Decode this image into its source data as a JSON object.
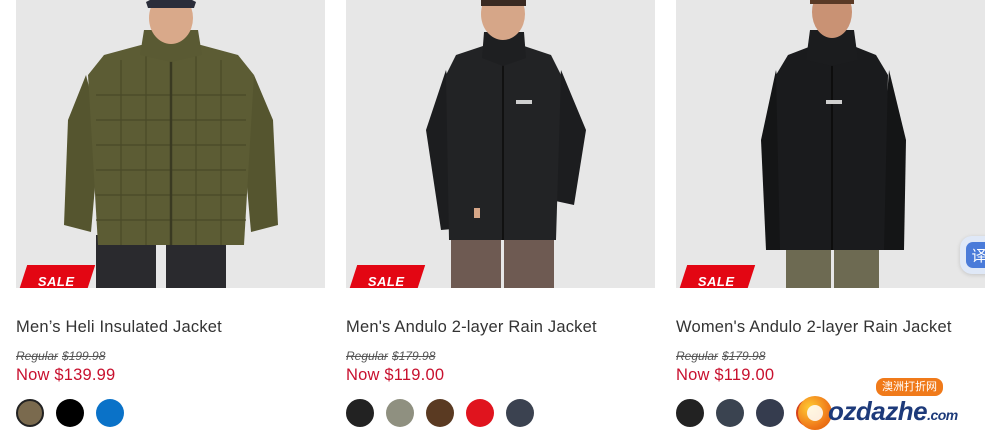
{
  "products": [
    {
      "image_alt": "Men's Heli Insulated Jacket",
      "badge": "SALE",
      "name": "Men’s Heli Insulated Jacket",
      "regular_label": "Regular",
      "regular_price": "$199.98",
      "now_price": "Now $139.99",
      "swatches": [
        {
          "color": "#7a6a4e",
          "selected": true
        },
        {
          "color": "#000000",
          "selected": false
        },
        {
          "color": "#0a72c8",
          "selected": false
        }
      ]
    },
    {
      "image_alt": "Men's Andulo 2-layer Rain Jacket",
      "badge": "SALE",
      "name": "Men's Andulo 2-layer Rain Jacket",
      "regular_label": "Regular",
      "regular_price": "$179.98",
      "now_price": "Now $119.00",
      "swatches": [
        {
          "color": "#222222",
          "selected": true
        },
        {
          "color": "#8f9080",
          "selected": false
        },
        {
          "color": "#5a3a22",
          "selected": false
        },
        {
          "color": "#e0141e",
          "selected": false
        },
        {
          "color": "#3b4250",
          "selected": false
        }
      ]
    },
    {
      "image_alt": "Women's Andulo 2-layer Rain Jacket",
      "badge": "SALE",
      "name": "Women's Andulo 2-layer Rain Jacket",
      "regular_label": "Regular",
      "regular_price": "$179.98",
      "now_price": "Now $119.00",
      "swatches": [
        {
          "color": "#222222",
          "selected": true
        },
        {
          "color": "#3a4350",
          "selected": false
        },
        {
          "color": "#353c4e",
          "selected": false
        },
        {
          "color": "#d6421a",
          "selected": false
        }
      ]
    }
  ],
  "translate_button": {
    "glyph": "译",
    "icon": "translate-icon"
  },
  "watermark": {
    "tag": "澳洲打折网",
    "main": "ozdazhe",
    "suffix": ".com"
  },
  "colors": {
    "sale_red": "#e30613",
    "price_red": "#c8102e"
  }
}
